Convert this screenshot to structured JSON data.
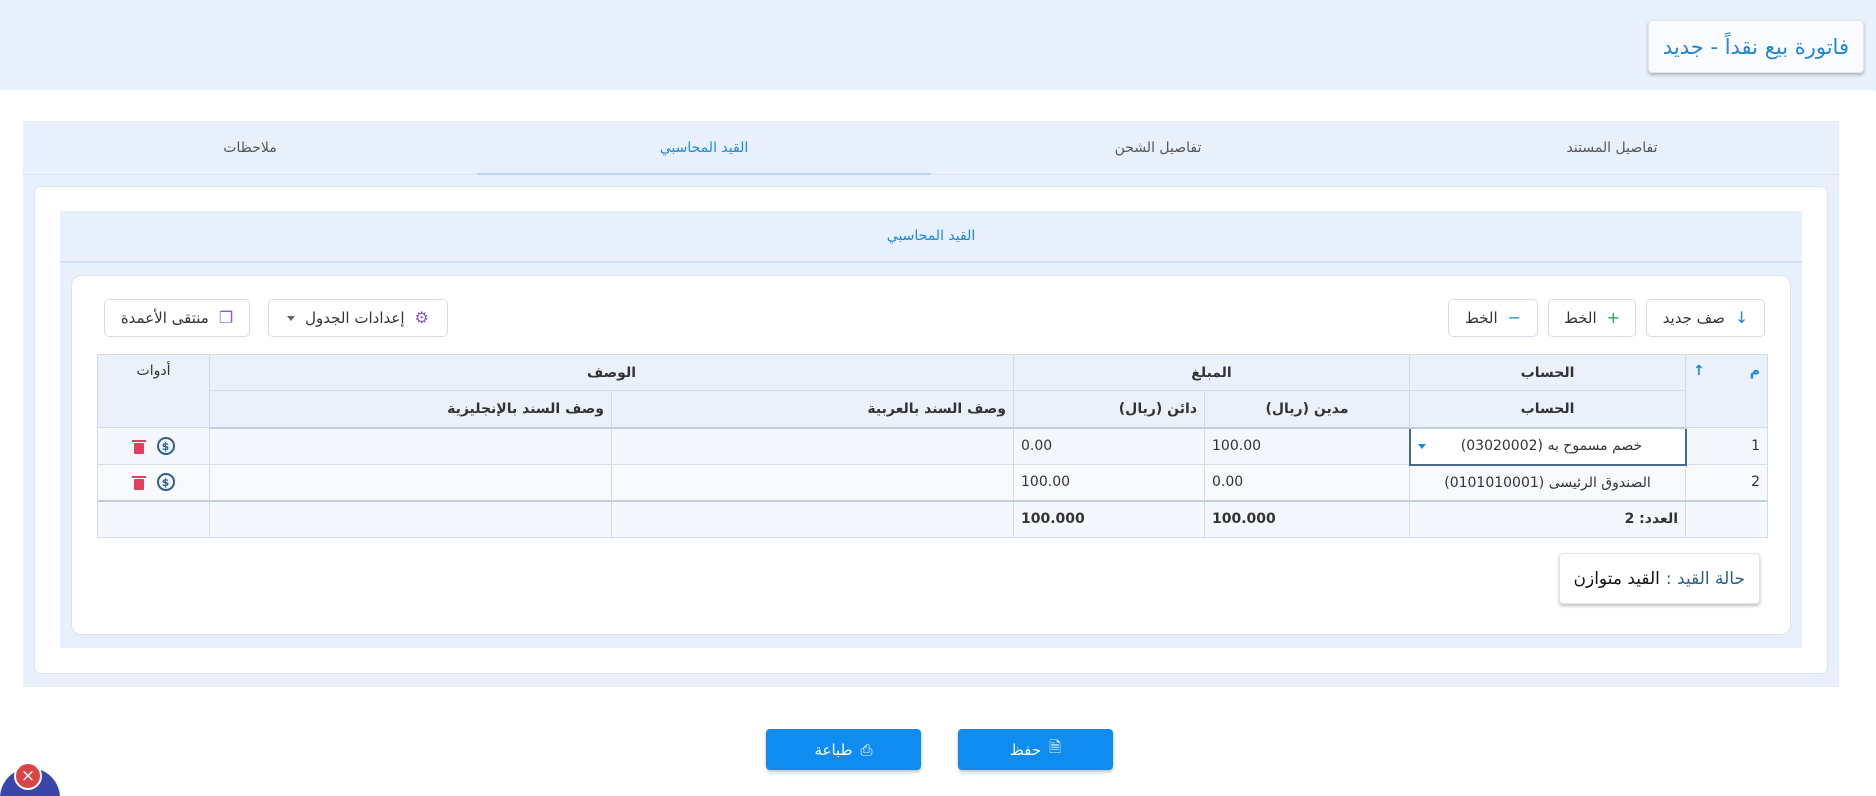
{
  "header": {
    "title": "فاتورة بيع نقداً - جديد"
  },
  "tabs": [
    {
      "label": "تفاصيل المستند",
      "active": false
    },
    {
      "label": "تفاصيل الشحن",
      "active": false
    },
    {
      "label": "القيد المحاسبي",
      "active": true
    },
    {
      "label": "ملاحظات",
      "active": false
    }
  ],
  "section": {
    "title": "القيد المحاسبي"
  },
  "toolbar": {
    "new_row": "صف جديد",
    "add_font": "الخط",
    "reduce_font": "الخط",
    "table_settings": "إعدادات الجدول",
    "column_picker": "منتقى الأعمدة"
  },
  "table": {
    "headers": {
      "index": "م",
      "sort_icon": "arrow-up-icon",
      "account_group": "الحساب",
      "amount_group": "المبلغ",
      "description_group": "الوصف",
      "tools": "أدوات",
      "account": "الحساب",
      "debit": "مدين (ريال)",
      "credit": "دائن (ريال)",
      "desc_ar": "وصف السند بالعربية",
      "desc_en": "وصف السند بالإنجليزية"
    },
    "rows": [
      {
        "index": "1",
        "account": "خصم مسموح به (03020002)",
        "debit": "100.00",
        "credit": "0.00",
        "desc_ar": "",
        "desc_en": ""
      },
      {
        "index": "2",
        "account": "الصندوق الرئيسى (0101010001)",
        "debit": "0.00",
        "credit": "100.00",
        "desc_ar": "",
        "desc_en": ""
      }
    ],
    "footer": {
      "count": "العدد: 2",
      "debit_total": "100.000",
      "credit_total": "100.000"
    }
  },
  "status": {
    "label": "حالة القيد :",
    "value": "القيد متوازن"
  },
  "actions": {
    "save": "حفظ",
    "print": "طباعة"
  },
  "colors": {
    "accent": "#1e88d8",
    "primary_button": "#0f8cf0",
    "danger": "#e23e5d"
  }
}
